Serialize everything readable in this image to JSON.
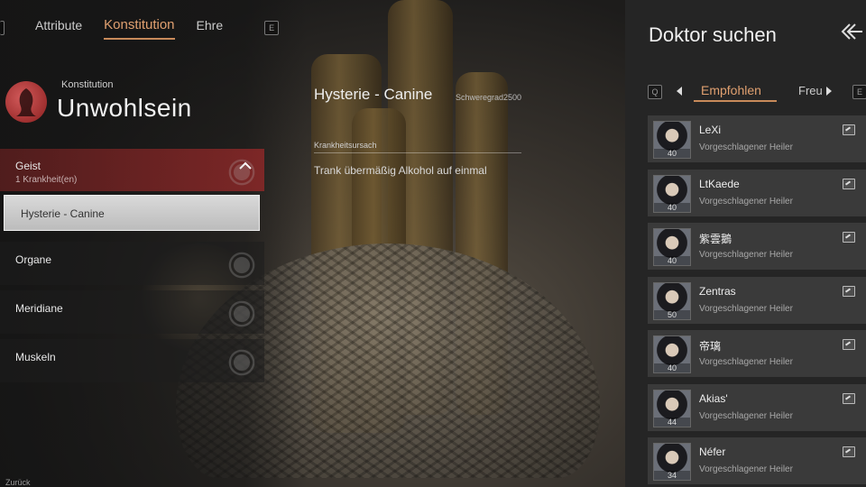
{
  "top_tabs": {
    "left_key": "",
    "right_key": "E",
    "items": [
      {
        "label": "Attribute"
      },
      {
        "label": "Konstitution"
      },
      {
        "label": "Ehre"
      }
    ]
  },
  "header": {
    "kicker": "Konstitution",
    "title": "Unwohlsein"
  },
  "categories": [
    {
      "label": "Geist",
      "sub": "1 Krankheit(en)",
      "expanded": true
    },
    {
      "label": "Organe"
    },
    {
      "label": "Meridiane"
    },
    {
      "label": "Muskeln"
    }
  ],
  "selected_item": "Hysterie - Canine",
  "details": {
    "title": "Hysterie - Canine",
    "severity": "Schweregrad2500",
    "cause_label": "Krankheitsursach",
    "cause_text": "Trank übermäßig Alkohol auf einmal"
  },
  "back_label": "Zurück",
  "panel": {
    "title": "Doktor suchen",
    "left_key": "Q",
    "right_key": "E",
    "tabs": [
      {
        "label": "Empfohlen"
      },
      {
        "label": "Freu"
      }
    ],
    "doctors": [
      {
        "name": "LeXi",
        "role": "Vorgeschlagener Heiler",
        "level": "40"
      },
      {
        "name": "LtKaede",
        "role": "Vorgeschlagener Heiler",
        "level": "40"
      },
      {
        "name": "紫雲鵝",
        "role": "Vorgeschlagener Heiler",
        "level": "40"
      },
      {
        "name": "Zentras",
        "role": "Vorgeschlagener Heiler",
        "level": "50"
      },
      {
        "name": "帝璃",
        "role": "Vorgeschlagener Heiler",
        "level": "40"
      },
      {
        "name": "Akias'",
        "role": "Vorgeschlagener Heiler",
        "level": "44"
      },
      {
        "name": "Néfer",
        "role": "Vorgeschlagener Heiler",
        "level": "34"
      }
    ]
  },
  "colors": {
    "accent": "#e0a070",
    "expanded_bg": "#8a2a2a",
    "panel_bg": "#252525",
    "row_bg": "#3a3a3a"
  }
}
